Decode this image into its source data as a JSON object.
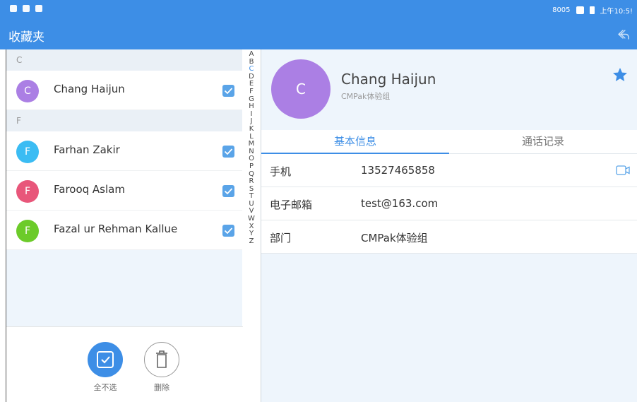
{
  "status_bar": {
    "left_icons": [
      "notification-icon",
      "wifi-icon",
      "message-icon"
    ],
    "right_text": "8005",
    "time": "上午10:5!"
  },
  "app_bar": {
    "title": "收藏夹",
    "share_icon": "share-icon"
  },
  "contacts": {
    "sections": [
      {
        "letter": "C",
        "items": [
          {
            "initial": "C",
            "name": "Chang Haijun",
            "color": "#ab7fe4",
            "checked": true
          }
        ]
      },
      {
        "letter": "F",
        "items": [
          {
            "initial": "F",
            "name": "Farhan Zakir",
            "color": "#3bbcf3",
            "checked": true
          },
          {
            "initial": "F",
            "name": "Farooq Aslam",
            "color": "#e8567a",
            "checked": true
          },
          {
            "initial": "F",
            "name": "Fazal ur Rehman Kallue",
            "color": "#6ccb2a",
            "checked": true
          }
        ]
      }
    ]
  },
  "alphabet": [
    "A",
    "B",
    "C",
    "D",
    "E",
    "F",
    "G",
    "H",
    "I",
    "J",
    "K",
    "L",
    "M",
    "N",
    "O",
    "P",
    "Q",
    "R",
    "S",
    "T",
    "U",
    "V",
    "W",
    "X",
    "Y",
    "Z"
  ],
  "alphabet_active": "C",
  "bottom_bar": {
    "select_none_label": "全不选",
    "delete_label": "删除"
  },
  "detail": {
    "initial": "C",
    "name": "Chang Haijun",
    "dept": "CMPak体验组",
    "favorite_icon": "star-icon",
    "tabs": [
      {
        "label": "基本信息",
        "active": true
      },
      {
        "label": "通话记录",
        "active": false
      }
    ],
    "fields": [
      {
        "label": "手机",
        "value": "13527465858"
      },
      {
        "label": "电子邮箱",
        "value": "test@163.com"
      },
      {
        "label": "部门",
        "value": "CMPak体验组"
      }
    ]
  },
  "colors": {
    "accent": "#3d8ee6",
    "pane_bg": "#eef5fc"
  }
}
